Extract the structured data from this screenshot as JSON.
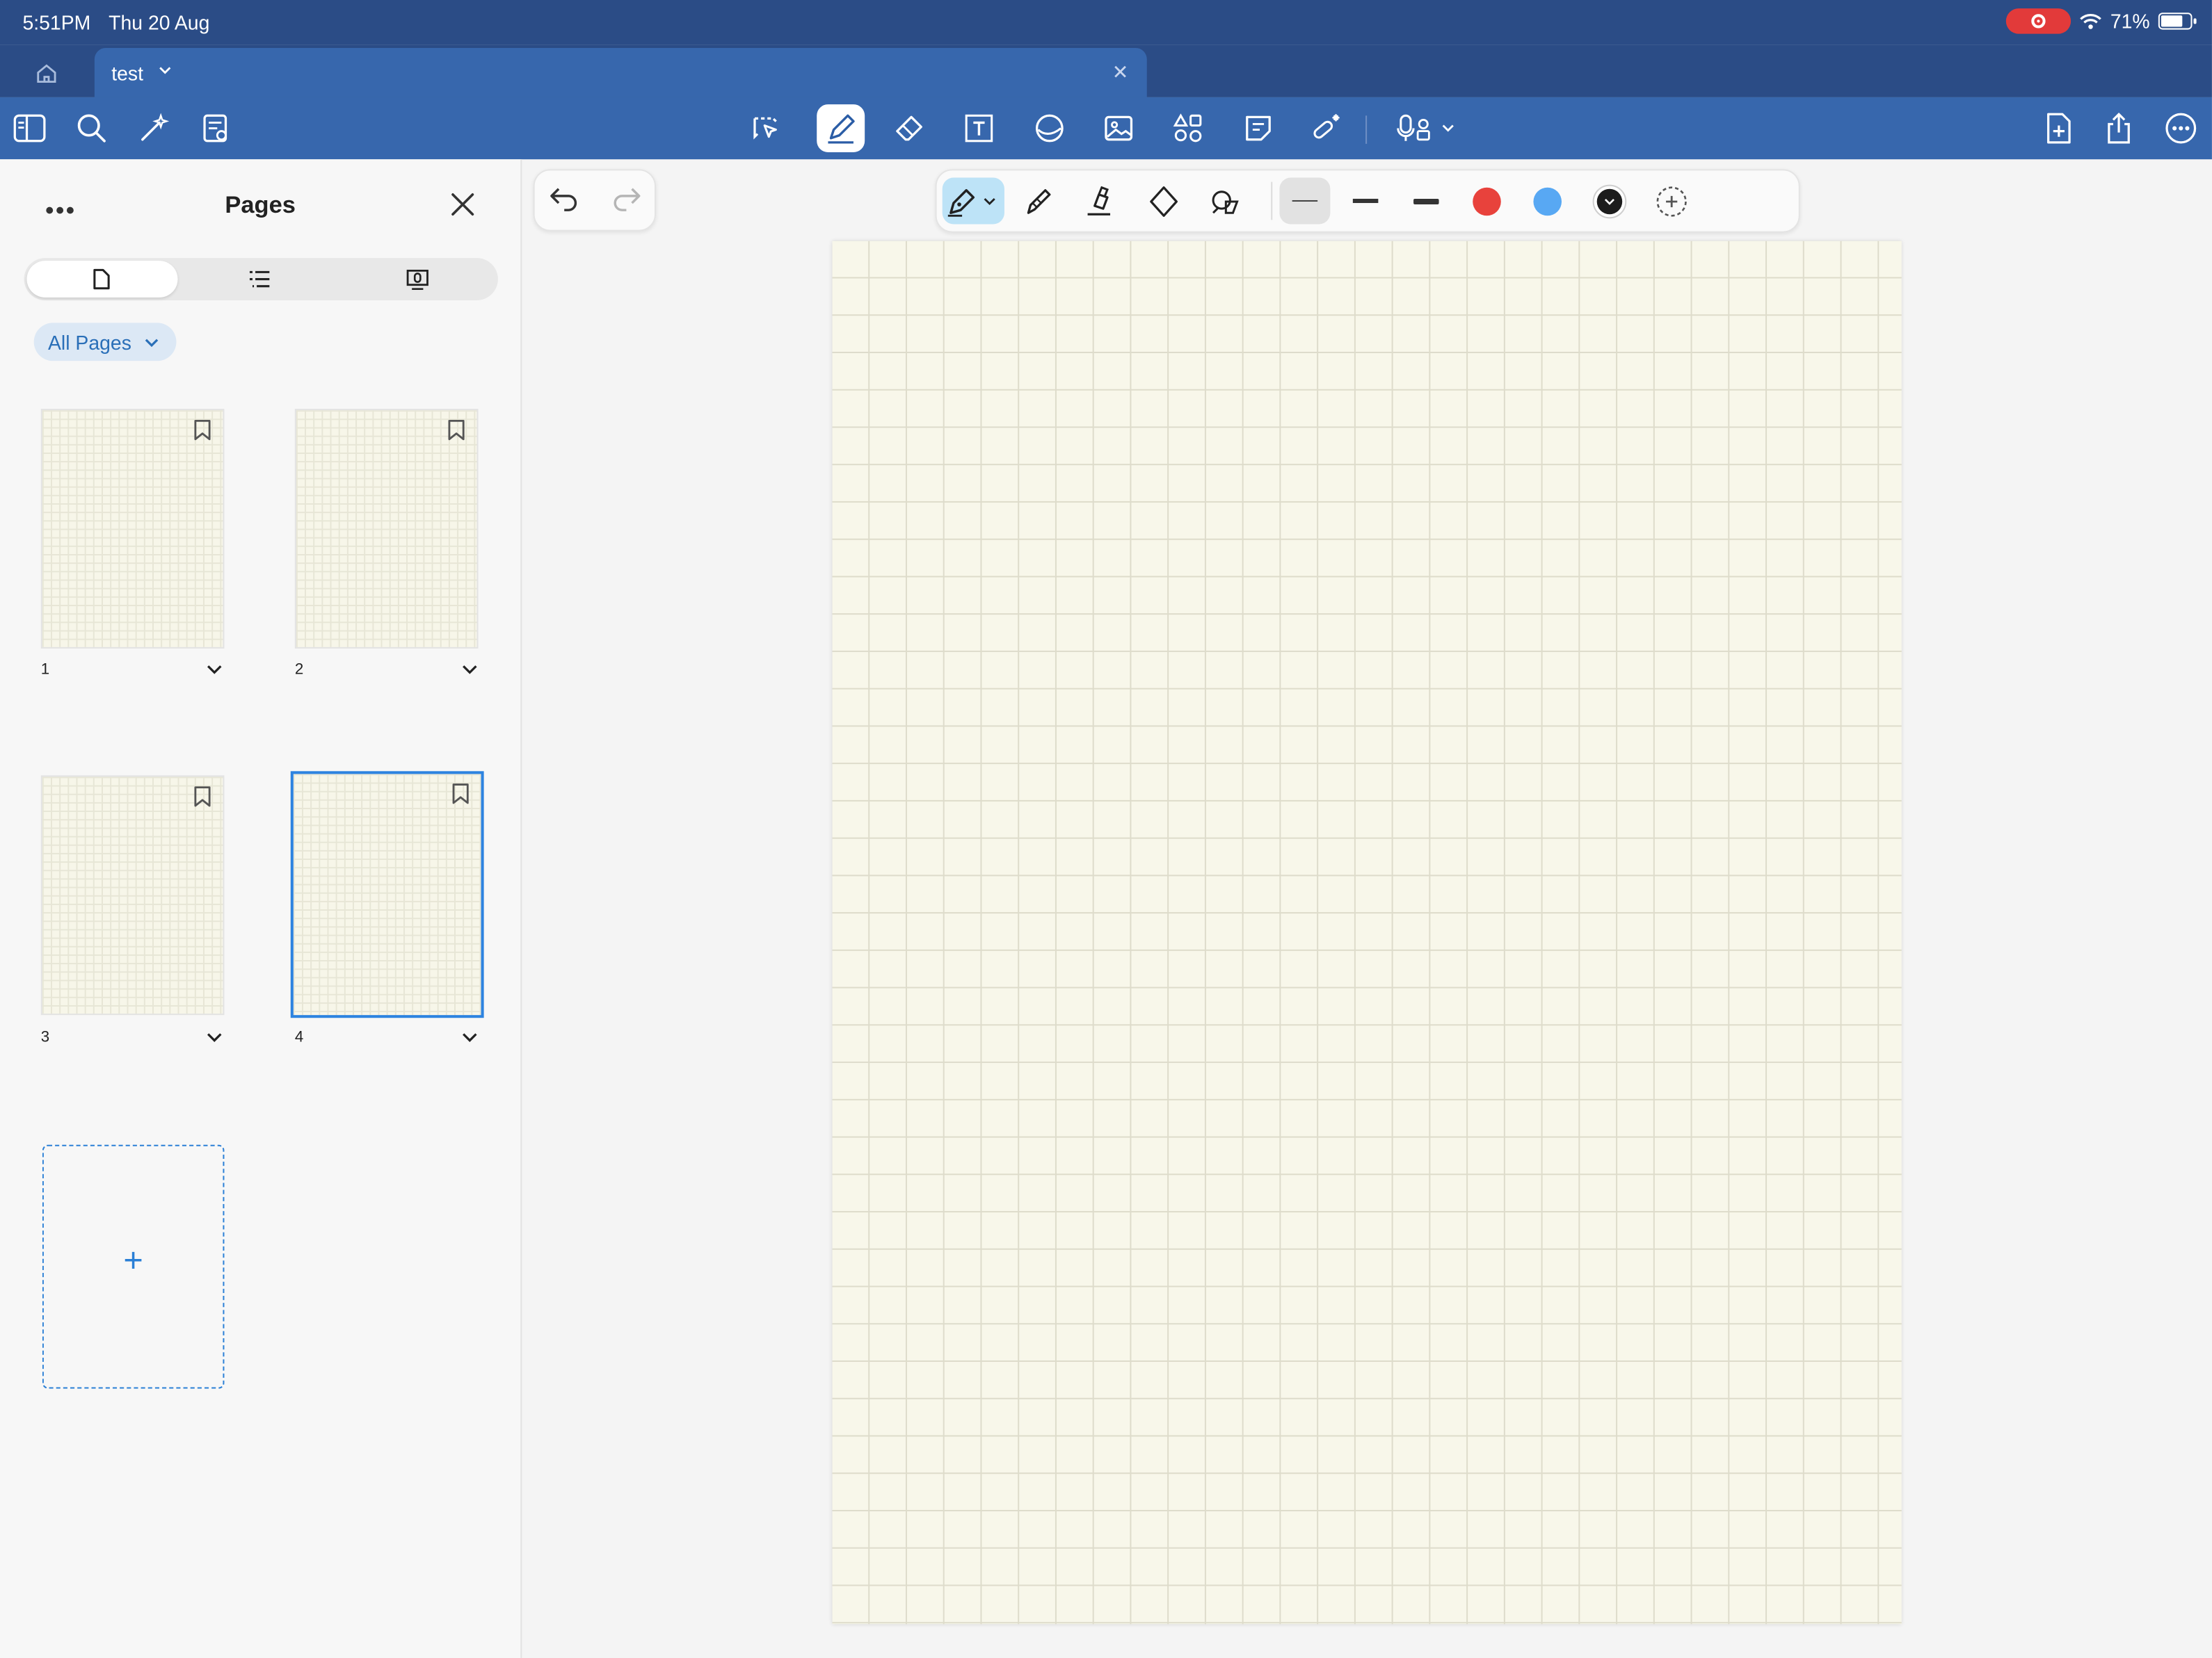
{
  "status_bar": {
    "time": "5:51PM",
    "date": "Thu 20 Aug",
    "battery": "71%"
  },
  "tab": {
    "title": "test"
  },
  "toolbar": {
    "left_icons": [
      "sidebar-icon",
      "search-icon",
      "sparkle-icon",
      "document-icon"
    ],
    "center_icons": [
      "lasso-icon",
      "pen-icon",
      "eraser-icon",
      "textbox-icon",
      "shape-icon",
      "image-icon",
      "elements-icon",
      "sticky-note-icon",
      "laser-icon",
      "microphone-icon"
    ],
    "right_icons": [
      "add-page-icon",
      "share-icon",
      "more-icon"
    ],
    "active_tool": "pen"
  },
  "sidebar": {
    "title": "Pages",
    "more_label": "•••",
    "filter_label": "All Pages",
    "segments": [
      "pages-icon",
      "outline-icon",
      "recordings-icon"
    ],
    "pages": [
      {
        "number": "1",
        "selected": false
      },
      {
        "number": "2",
        "selected": false
      },
      {
        "number": "3",
        "selected": false
      },
      {
        "number": "4",
        "selected": true
      }
    ],
    "add_label": "+"
  },
  "pen_toolbar": {
    "tools": [
      "fountain-pen-icon",
      "ball-pen-icon",
      "highlighter-icon",
      "ruler-icon",
      "shape-recognition-icon"
    ],
    "widths": [
      "thin",
      "medium",
      "thick"
    ],
    "selected_width": "thin",
    "colors": [
      "#e8423c",
      "#58a8f3",
      "#1c1c1c"
    ],
    "selected_color": "#1c1c1c"
  },
  "colors": {
    "header": "#2b4c86",
    "toolbar": "#3767ad",
    "accent": "#2d83e0",
    "paper": "#f8f7ea"
  }
}
